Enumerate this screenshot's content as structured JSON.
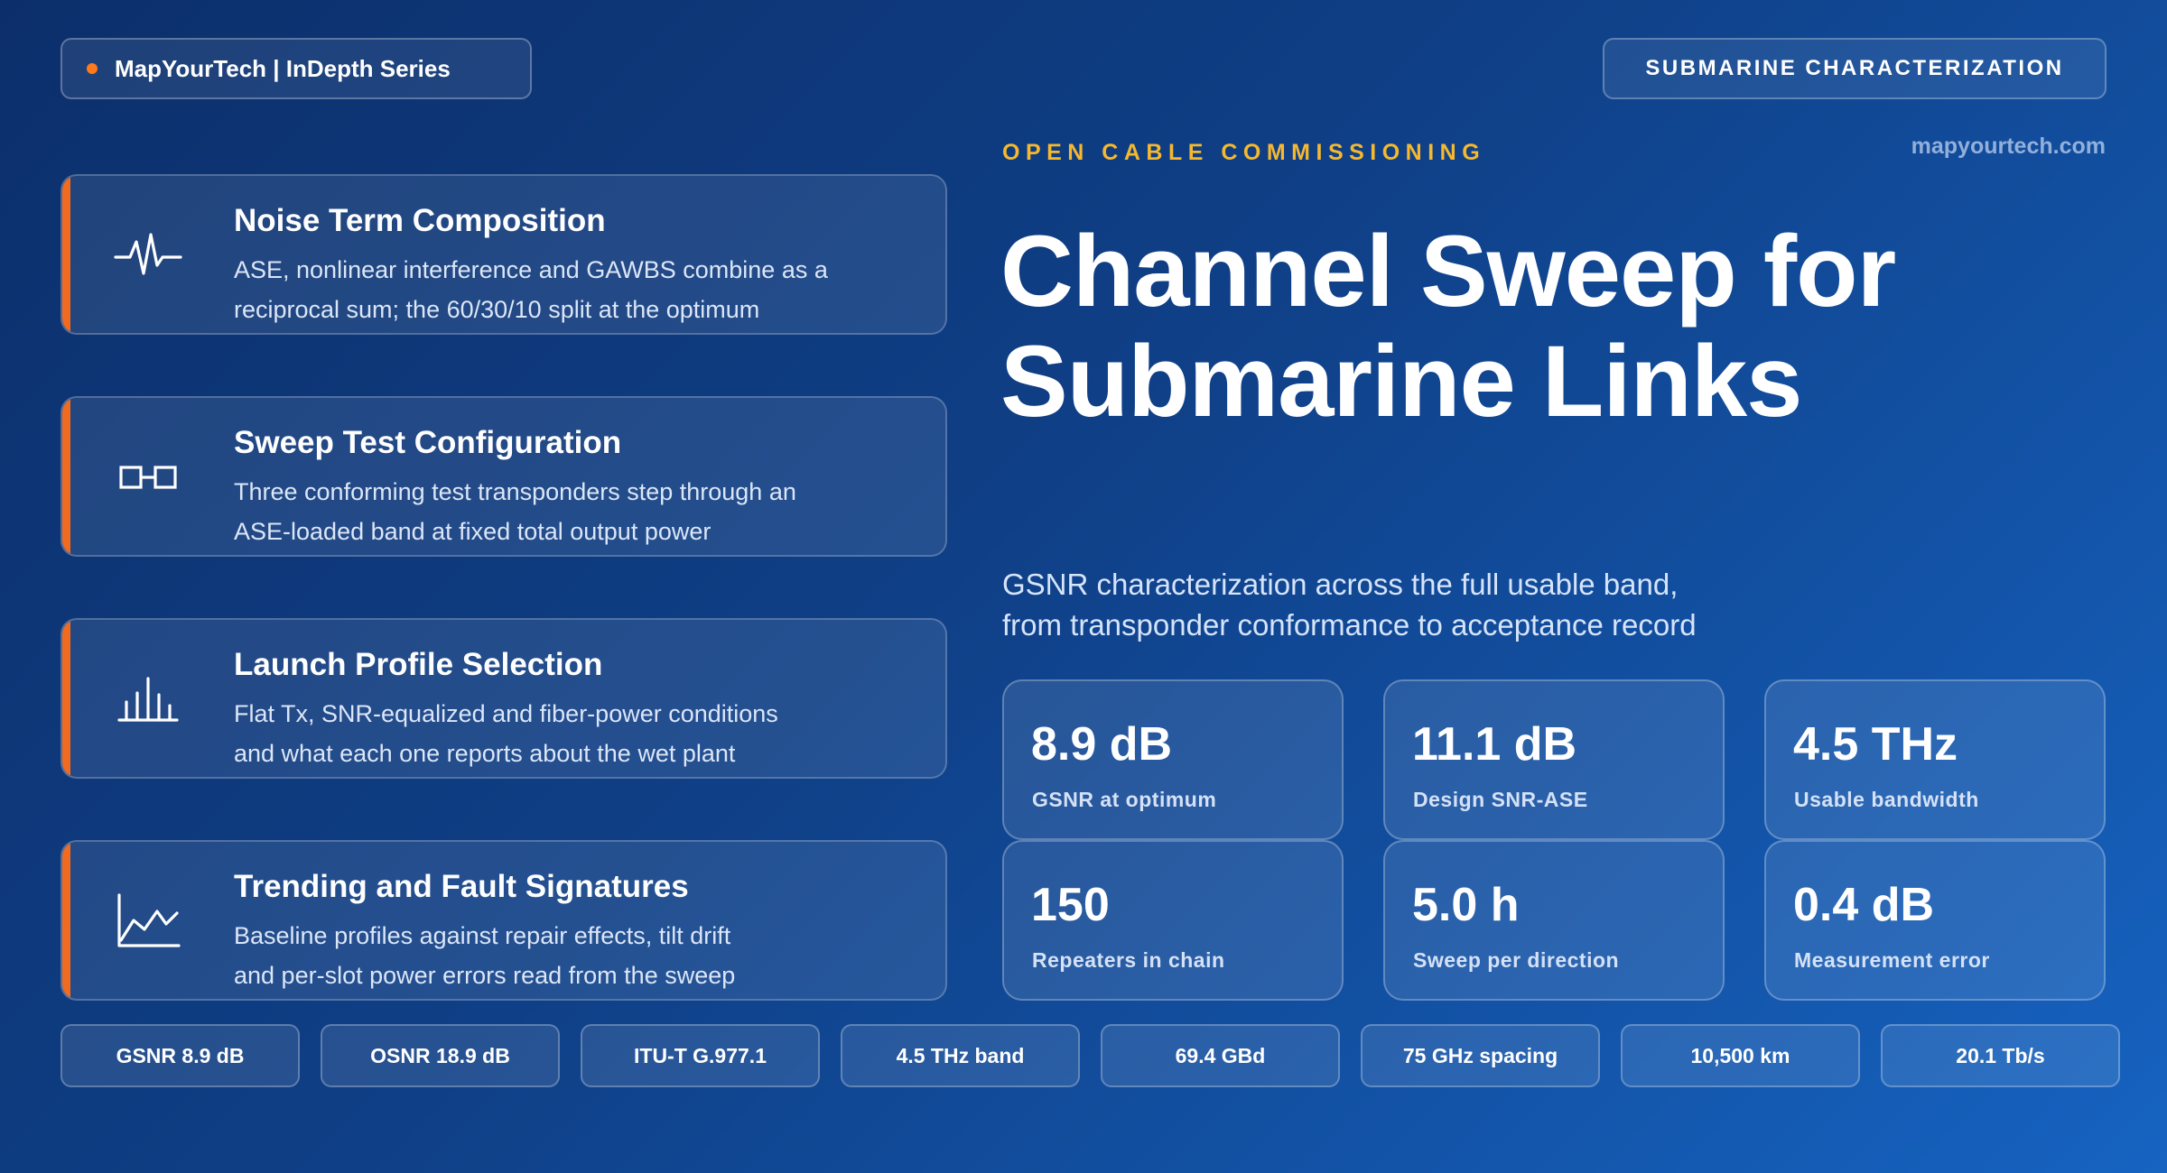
{
  "header": {
    "brand": "MapYourTech | InDepth Series",
    "topic": "SUBMARINE CHARACTERIZATION",
    "site": "mapyourtech.com"
  },
  "hero": {
    "eyebrow": "OPEN CABLE COMMISSIONING",
    "title_line1": "Channel Sweep for",
    "title_line2": "Submarine Links",
    "subtitle_line1": "GSNR characterization across the full usable band,",
    "subtitle_line2": "from transponder conformance to acceptance record"
  },
  "cards": [
    {
      "icon": "waveform-icon",
      "title": "Noise Term Composition",
      "line1": "ASE, nonlinear interference and GAWBS combine as a",
      "line2": "reciprocal sum; the 60/30/10 split at the optimum"
    },
    {
      "icon": "transponders-icon",
      "title": "Sweep Test Configuration",
      "line1": "Three conforming test transponders step through an",
      "line2": "ASE-loaded band at fixed total output power"
    },
    {
      "icon": "bar-chart-icon",
      "title": "Launch Profile Selection",
      "line1": "Flat Tx, SNR-equalized and fiber-power conditions",
      "line2": "and what each one reports about the wet plant"
    },
    {
      "icon": "line-chart-icon",
      "title": "Trending and Fault Signatures",
      "line1": "Baseline profiles against repair effects, tilt drift",
      "line2": "and per-slot power errors read from the sweep"
    }
  ],
  "stats": [
    {
      "value": "8.9 dB",
      "label": "GSNR at optimum"
    },
    {
      "value": "11.1 dB",
      "label": "Design SNR-ASE"
    },
    {
      "value": "4.5 THz",
      "label": "Usable bandwidth"
    },
    {
      "value": "150",
      "label": "Repeaters in chain"
    },
    {
      "value": "5.0 h",
      "label": "Sweep per direction"
    },
    {
      "value": "0.4 dB",
      "label": "Measurement error"
    }
  ],
  "tags": [
    "GSNR 8.9 dB",
    "OSNR 18.9 dB",
    "ITU-T G.977.1",
    "4.5 THz band",
    "69.4 GBd",
    "75 GHz spacing",
    "10,500 km",
    "20.1 Tb/s"
  ],
  "colors": {
    "accent": "#f06a1f",
    "eyebrow": "#f5b82e",
    "dot": "#ff7a1a"
  }
}
